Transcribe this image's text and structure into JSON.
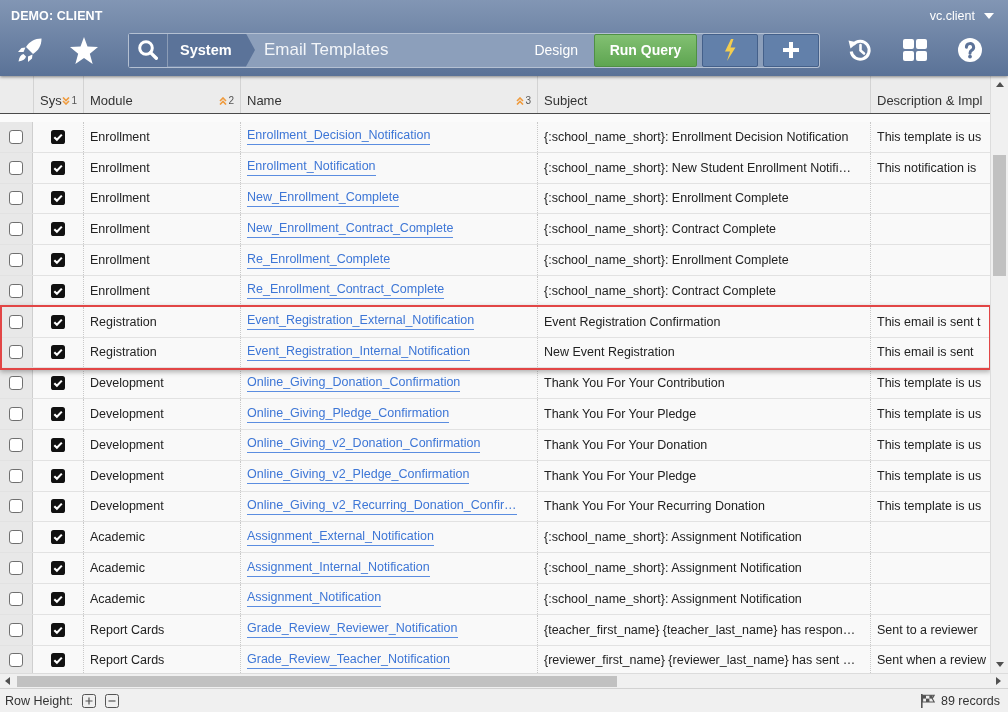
{
  "window": {
    "title": "DEMO: CLIENT",
    "user": "vc.client"
  },
  "toolbar": {
    "breadcrumb": {
      "section": "System",
      "page": "Email Templates"
    },
    "design_label": "Design",
    "run_button": "Run Query"
  },
  "table": {
    "columns": [
      {
        "label": "Sys",
        "sort_ascending": false,
        "sort_order": "1"
      },
      {
        "label": "Module",
        "sort_ascending": true,
        "sort_order": "2"
      },
      {
        "label": "Name",
        "sort_ascending": true,
        "sort_order": "3"
      },
      {
        "label": "Subject"
      },
      {
        "label": "Description & Impl"
      }
    ],
    "rows": [
      {
        "selected": false,
        "system": true,
        "highlighted": false,
        "module": "Enrollment",
        "name": "Enrollment_Decision_Notification",
        "subject": "{:school_name_short}: Enrollment Decision Notification",
        "description": "This template is us"
      },
      {
        "selected": false,
        "system": true,
        "highlighted": false,
        "module": "Enrollment",
        "name": "Enrollment_Notification",
        "subject": "{:school_name_short}: New Student Enrollment Notifi…",
        "description": "This notification is"
      },
      {
        "selected": false,
        "system": true,
        "highlighted": false,
        "module": "Enrollment",
        "name": "New_Enrollment_Complete",
        "subject": "{:school_name_short}: Enrollment Complete"
      },
      {
        "selected": false,
        "system": true,
        "highlighted": false,
        "module": "Enrollment",
        "name": "New_Enrollment_Contract_Complete",
        "subject": "{:school_name_short}: Contract Complete"
      },
      {
        "selected": false,
        "system": true,
        "highlighted": false,
        "module": "Enrollment",
        "name": "Re_Enrollment_Complete",
        "subject": "{:school_name_short}: Enrollment Complete"
      },
      {
        "selected": false,
        "system": true,
        "highlighted": false,
        "module": "Enrollment",
        "name": "Re_Enrollment_Contract_Complete",
        "subject": "{:school_name_short}: Contract Complete"
      },
      {
        "selected": false,
        "system": true,
        "highlighted": true,
        "module": "Registration",
        "name": "Event_Registration_External_Notification",
        "subject": "Event Registration Confirmation",
        "description": "This email is sent t"
      },
      {
        "selected": false,
        "system": true,
        "highlighted": true,
        "module": "Registration",
        "name": "Event_Registration_Internal_Notification",
        "subject": "New Event Registration",
        "description": "This email is sent"
      },
      {
        "selected": false,
        "system": true,
        "highlighted": false,
        "module": "Development",
        "name": "Online_Giving_Donation_Confirmation",
        "subject": "Thank You For Your Contribution",
        "description": "This template is us"
      },
      {
        "selected": false,
        "system": true,
        "highlighted": false,
        "module": "Development",
        "name": "Online_Giving_Pledge_Confirmation",
        "subject": "Thank You For Your Pledge",
        "description": "This template is us"
      },
      {
        "selected": false,
        "system": true,
        "highlighted": false,
        "module": "Development",
        "name": "Online_Giving_v2_Donation_Confirmation",
        "subject": "Thank You For Your Donation",
        "description": "This template is us"
      },
      {
        "selected": false,
        "system": true,
        "highlighted": false,
        "module": "Development",
        "name": "Online_Giving_v2_Pledge_Confirmation",
        "subject": "Thank You For Your Pledge",
        "description": "This template is us"
      },
      {
        "selected": false,
        "system": true,
        "highlighted": false,
        "module": "Development",
        "name": "Online_Giving_v2_Recurring_Donation_Confir…",
        "subject": "Thank You For Your Recurring Donation",
        "description": "This template is us"
      },
      {
        "selected": false,
        "system": true,
        "highlighted": false,
        "module": "Academic",
        "name": "Assignment_External_Notification",
        "subject": "{:school_name_short}: Assignment Notification"
      },
      {
        "selected": false,
        "system": true,
        "highlighted": false,
        "module": "Academic",
        "name": "Assignment_Internal_Notification",
        "subject": "{:school_name_short}: Assignment Notification"
      },
      {
        "selected": false,
        "system": true,
        "highlighted": false,
        "module": "Academic",
        "name": "Assignment_Notification",
        "subject": "{:school_name_short}: Assignment Notification"
      },
      {
        "selected": false,
        "system": true,
        "highlighted": false,
        "module": "Report Cards",
        "name": "Grade_Review_Reviewer_Notification",
        "subject": "{teacher_first_name} {teacher_last_name} has respon…",
        "description": "Sent to a reviewer"
      },
      {
        "selected": false,
        "system": true,
        "highlighted": false,
        "module": "Report Cards",
        "name": "Grade_Review_Teacher_Notification",
        "subject": "{reviewer_first_name} {reviewer_last_name} has sent …",
        "description": "Sent when a review"
      }
    ]
  },
  "status_bar": {
    "row_height_label": "Row Height:",
    "record_count": "89 records"
  }
}
